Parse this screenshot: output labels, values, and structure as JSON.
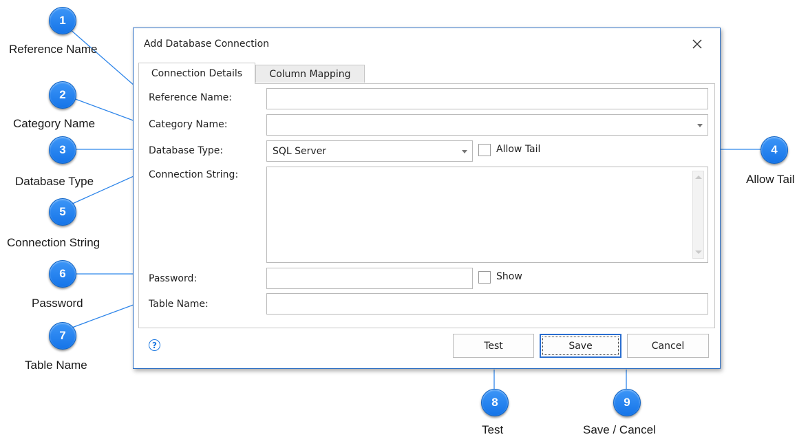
{
  "callouts": [
    {
      "num": "1",
      "label": "Reference Name"
    },
    {
      "num": "2",
      "label": "Category Name"
    },
    {
      "num": "3",
      "label": "Database Type"
    },
    {
      "num": "4",
      "label": "Allow Tail"
    },
    {
      "num": "5",
      "label": "Connection String"
    },
    {
      "num": "6",
      "label": "Password"
    },
    {
      "num": "7",
      "label": "Table Name"
    },
    {
      "num": "8",
      "label": "Test"
    },
    {
      "num": "9",
      "label": "Save / Cancel"
    }
  ],
  "dialog": {
    "title": "Add Database Connection",
    "tabs": [
      {
        "label": "Connection Details",
        "active": true
      },
      {
        "label": "Column Mapping",
        "active": false
      }
    ],
    "fields": {
      "reference_name": {
        "label": "Reference Name:",
        "value": ""
      },
      "category_name": {
        "label": "Category Name:",
        "value": ""
      },
      "database_type": {
        "label": "Database Type:",
        "value": "SQL Server"
      },
      "allow_tail": {
        "label": "Allow Tail",
        "checked": false
      },
      "connection_string": {
        "label": "Connection String:",
        "value": ""
      },
      "password": {
        "label": "Password:",
        "value": ""
      },
      "show_password": {
        "label": "Show",
        "checked": false
      },
      "table_name": {
        "label": "Table Name:",
        "value": ""
      }
    },
    "buttons": {
      "help": "?",
      "test": "Test",
      "save": "Save",
      "cancel": "Cancel"
    }
  },
  "colors": {
    "callout": "#1a7ff0",
    "dialog_border": "#2d6fc4",
    "leader_line": "#2f86ea"
  }
}
